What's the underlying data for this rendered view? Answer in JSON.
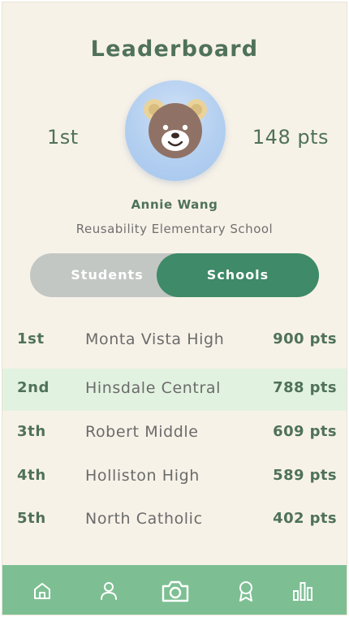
{
  "header": {
    "title": "Leaderboard"
  },
  "current_user": {
    "rank": "1st",
    "points": "148 pts",
    "avatar": "bear-avatar",
    "name": "Annie Wang",
    "school": "Reusability Elementary School"
  },
  "toggle": {
    "students_label": "Students",
    "schools_label": "Schools",
    "selected": "Schools"
  },
  "leaderboard": [
    {
      "rank": "1st",
      "name": "Monta Vista High",
      "points": "900 pts",
      "highlighted": false
    },
    {
      "rank": "2nd",
      "name": "Hinsdale Central",
      "points": "788 pts",
      "highlighted": true
    },
    {
      "rank": "3th",
      "name": "Robert Middle",
      "points": "609 pts",
      "highlighted": false
    },
    {
      "rank": "4th",
      "name": "Holliston High",
      "points": "589 pts",
      "highlighted": false
    },
    {
      "rank": "5th",
      "name": "North Catholic",
      "points": "402 pts",
      "highlighted": false
    }
  ],
  "bottom_nav": [
    "home-icon",
    "profile-icon",
    "camera-icon",
    "award-icon",
    "chart-icon"
  ],
  "colors": {
    "background": "#f7f2e8",
    "primary_green": "#3f8a68",
    "nav_green": "#7dbf93",
    "highlight_row": "#e2f2e0",
    "toggle_inactive": "#c3c7c4"
  }
}
